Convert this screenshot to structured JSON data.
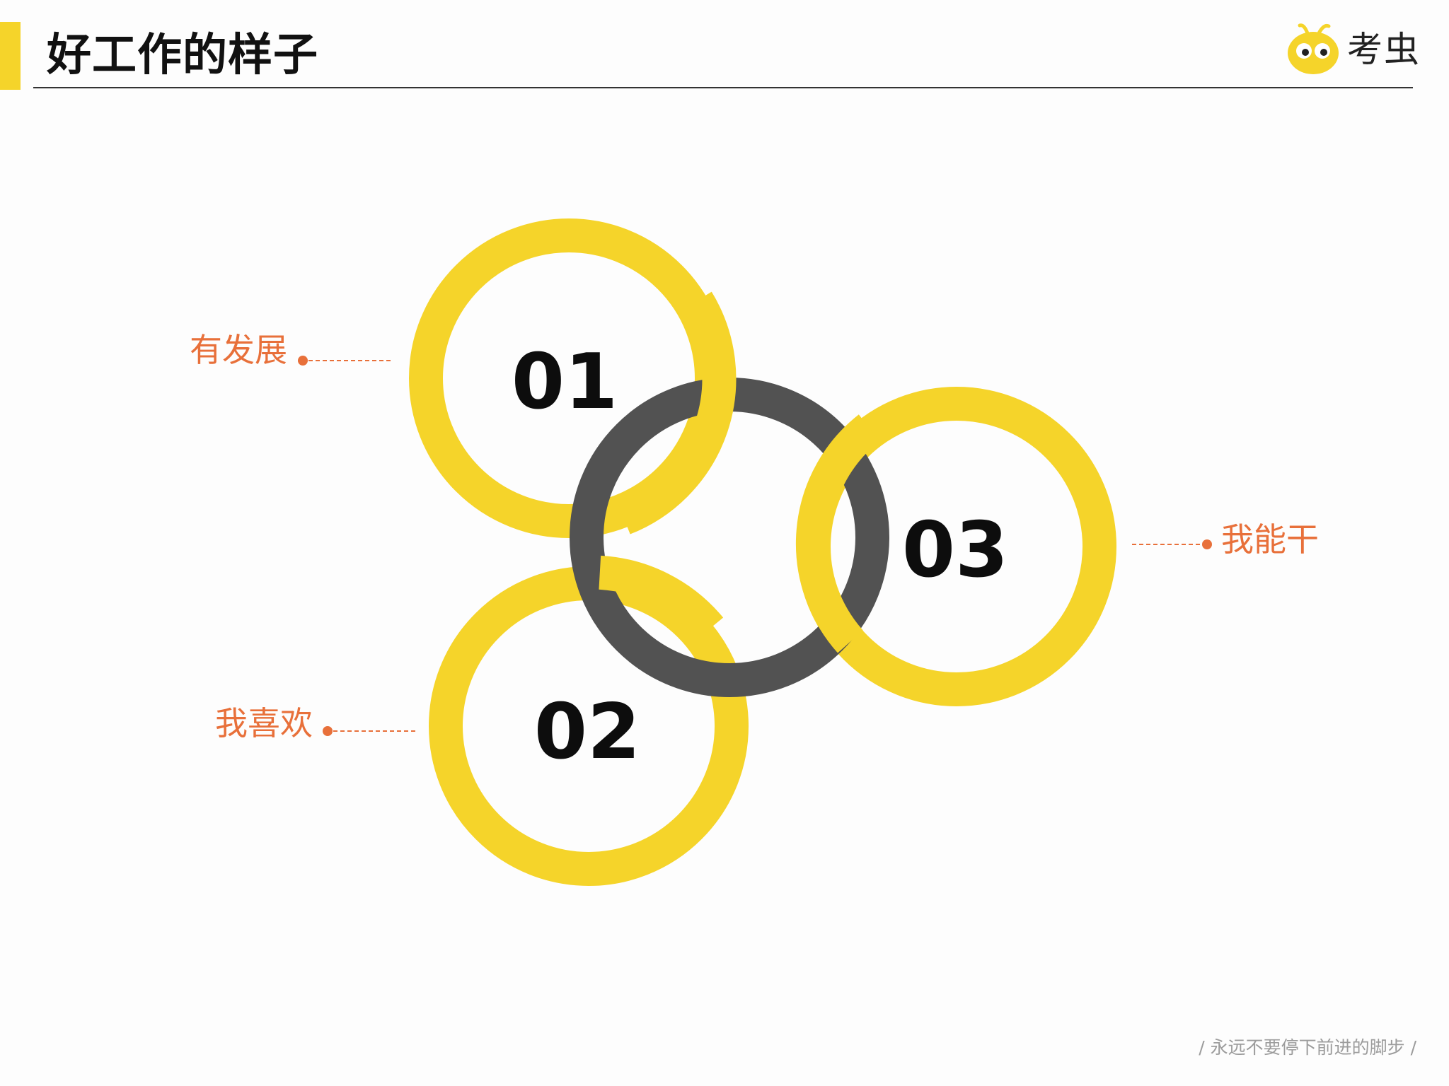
{
  "header": {
    "title": "好工作的样子",
    "logo_text": "考虫",
    "logo_icon": "bug-mascot-icon"
  },
  "diagram": {
    "rings": [
      {
        "number": "01",
        "label": "有发展",
        "color": "#f5d42a"
      },
      {
        "number": "02",
        "label": "我喜欢",
        "color": "#f5d42a"
      },
      {
        "number": "03",
        "label": "我能干",
        "color": "#f5d42a"
      }
    ],
    "center_ring_color": "#525252",
    "callout_color": "#e8703a"
  },
  "footer": {
    "slogan": "/ 永远不要停下前进的脚步 /"
  }
}
